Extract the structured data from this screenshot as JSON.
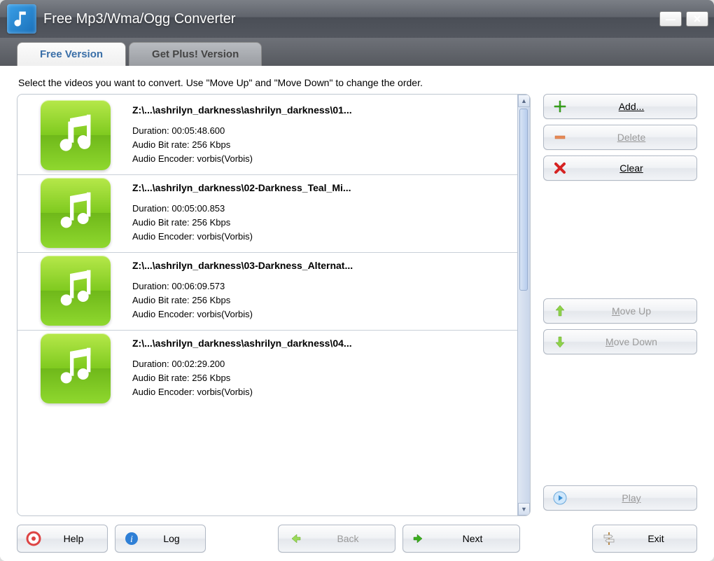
{
  "window": {
    "title": "Free Mp3/Wma/Ogg Converter"
  },
  "tabs": {
    "active": "Free Version",
    "inactive": "Get Plus! Version"
  },
  "instruction": "Select the videos you want to convert. Use \"Move Up\" and \"Move Down\" to change the order.",
  "items": [
    {
      "path": "Z:\\...\\ashrilyn_darkness\\ashrilyn_darkness\\01...",
      "duration_label": "Duration: 00:05:48.600",
      "bitrate_label": "Audio Bit rate: 256 Kbps",
      "encoder_label": "Audio Encoder: vorbis(Vorbis)"
    },
    {
      "path": "Z:\\...\\ashrilyn_darkness\\02-Darkness_Teal_Mi...",
      "duration_label": "Duration: 00:05:00.853",
      "bitrate_label": "Audio Bit rate: 256 Kbps",
      "encoder_label": "Audio Encoder: vorbis(Vorbis)"
    },
    {
      "path": "Z:\\...\\ashrilyn_darkness\\03-Darkness_Alternat...",
      "duration_label": "Duration: 00:06:09.573",
      "bitrate_label": "Audio Bit rate: 256 Kbps",
      "encoder_label": "Audio Encoder: vorbis(Vorbis)"
    },
    {
      "path": "Z:\\...\\ashrilyn_darkness\\ashrilyn_darkness\\04...",
      "duration_label": "Duration: 00:02:29.200",
      "bitrate_label": "Audio Bit rate: 256 Kbps",
      "encoder_label": "Audio Encoder: vorbis(Vorbis)"
    }
  ],
  "side_buttons": {
    "add": "Add...",
    "delete": "Delete",
    "clear": "Clear",
    "move_up": "Move Up",
    "move_down": "Move Down",
    "play": "Play"
  },
  "bottom_buttons": {
    "help": "Help",
    "log": "Log",
    "back": "Back",
    "next": "Next",
    "exit": "Exit"
  }
}
